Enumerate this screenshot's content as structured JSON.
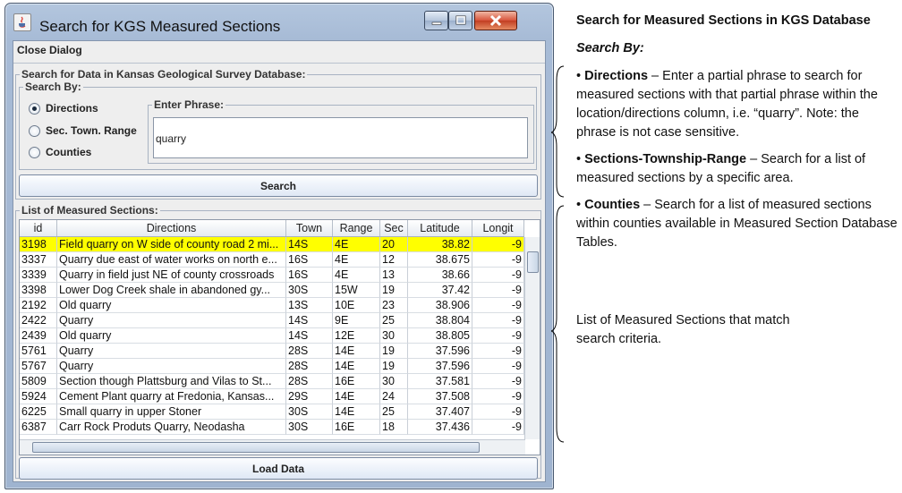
{
  "window": {
    "title": "Search for KGS Measured Sections"
  },
  "close_dialog": "Close Dialog",
  "search_group": {
    "label": "Search for Data in Kansas Geological Survey Database:",
    "search_by_label": "Search By:",
    "options": [
      "Directions",
      "Sec. Town. Range",
      "Counties"
    ],
    "selected": "Directions",
    "phrase_label": "Enter Phrase:",
    "phrase_value": "quarry",
    "search_button": "Search"
  },
  "list_group": {
    "label": "List of Measured Sections:",
    "columns": [
      "id",
      "Directions",
      "Town",
      "Range",
      "Sec",
      "Latitude",
      "Longit"
    ],
    "rows": [
      [
        "3198",
        "Field quarry on W side of county road 2 mi...",
        "14S",
        "4E",
        "20",
        "38.82",
        "-9"
      ],
      [
        "3337",
        "Quarry due east of water works on north e...",
        "16S",
        "4E",
        "12",
        "38.675",
        "-9"
      ],
      [
        "3339",
        "Quarry in field just NE of county crossroads",
        "16S",
        "4E",
        "13",
        "38.66",
        "-9"
      ],
      [
        "3398",
        "Lower Dog Creek shale in abandoned gy...",
        "30S",
        "15W",
        "19",
        "37.42",
        "-9"
      ],
      [
        "2192",
        "Old quarry",
        "13S",
        "10E",
        "23",
        "38.906",
        "-9"
      ],
      [
        "2422",
        "Quarry",
        "14S",
        "9E",
        "25",
        "38.804",
        "-9"
      ],
      [
        "2439",
        "Old quarry",
        "14S",
        "12E",
        "30",
        "38.805",
        "-9"
      ],
      [
        "5761",
        "Quarry",
        "28S",
        "14E",
        "19",
        "37.596",
        "-9"
      ],
      [
        "5767",
        "Quarry",
        "28S",
        "14E",
        "19",
        "37.596",
        "-9"
      ],
      [
        "5809",
        "Section though Plattsburg and Vilas to St...",
        "28S",
        "16E",
        "30",
        "37.581",
        "-9"
      ],
      [
        "5924",
        "Cement Plant quarry at Fredonia, Kansas...",
        "29S",
        "14E",
        "24",
        "37.508",
        "-9"
      ],
      [
        "6225",
        "Small quarry in upper Stoner",
        "30S",
        "14E",
        "25",
        "37.407",
        "-9"
      ],
      [
        "6387",
        "Carr Rock Produts Quarry, Neodasha",
        "30S",
        "16E",
        "18",
        "37.436",
        "-9"
      ]
    ],
    "selected_row": 0,
    "load_button": "Load Data"
  },
  "notes": {
    "heading": "Search for Measured Sections in KGS Database",
    "search_by": "Search By:",
    "directions_bullet": "• ",
    "directions_term": "Directions",
    "directions_text": " – Enter a partial phrase to search for measured sections with that partial phrase within the location/directions column, i.e. “quarry”. Note: the phrase is not case sensitive.",
    "str_bullet": "• ",
    "str_term": "Sections-Township-Range",
    "str_text": " – Search for a list of measured sections by a specific area.",
    "counties_bullet": "• ",
    "counties_term": "Counties",
    "counties_text": " – Search for a list of measured sections within counties available in Measured Section Database Tables.",
    "list_text": "List of Measured Sections that match search criteria."
  },
  "colors": {
    "selected_row": "#ffff00",
    "bracket": "#000000"
  }
}
